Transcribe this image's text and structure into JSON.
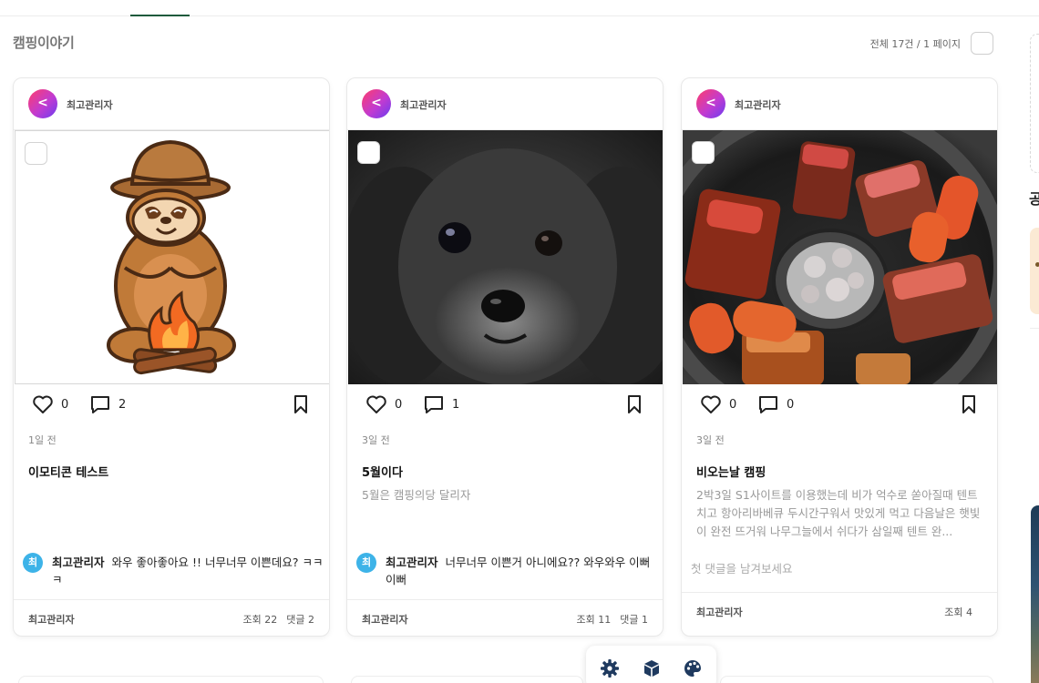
{
  "board": {
    "title": "캠핑이야기",
    "count_text": "전체 17건 / 1 페이지"
  },
  "posts": [
    {
      "avatar_letter": "<",
      "author": "최고관리자",
      "image": "sloth-camping-emoticon",
      "likes": "0",
      "comments": "2",
      "date": "1일 전",
      "title": "이모티콘 테스트",
      "body": "",
      "latest_comment": {
        "avatar_letter": "최",
        "author": "최고관리자",
        "text": "와우 좋아좋아요 !! 너무너무 이쁜데요? ㅋㅋㅋ"
      },
      "footer_author": "최고관리자",
      "views": "조회 22",
      "comment_count": "댓글 2"
    },
    {
      "avatar_letter": "<",
      "author": "최고관리자",
      "image": "black-poodle-photo",
      "likes": "0",
      "comments": "1",
      "date": "3일 전",
      "title": "5월이다",
      "body": "5월은 캠핑의당 달리자",
      "latest_comment": {
        "avatar_letter": "최",
        "author": "최고관리자",
        "text": "너무너무 이쁜거 아니에요?? 와우와우 이뻐이뻐"
      },
      "footer_author": "최고관리자",
      "views": "조회 11",
      "comment_count": "댓글 1"
    },
    {
      "avatar_letter": "<",
      "author": "최고관리자",
      "image": "grilled-meat-photo",
      "likes": "0",
      "comments": "0",
      "date": "3일 전",
      "title": "비오는날 캠핑",
      "body": "2박3일 S1사이트를 이용했는데 비가 억수로 쏟아질때 텐트치고 항아리바베큐 두시간구워서 맛있게 먹고 다음날은 햇빛이 완전 뜨거워 나무그늘에서 쉬다가 삼일째 텐트 완...",
      "no_comment_text": "첫 댓글을 남겨보세요",
      "footer_author": "최고관리자",
      "views": "조회 4"
    }
  ],
  "dock": {
    "buttons": [
      "gear-icon",
      "cube-icon",
      "palette-icon"
    ]
  },
  "colors": {
    "active_tab": "#1e5a3c",
    "comment_avatar": "#3db3e8"
  }
}
